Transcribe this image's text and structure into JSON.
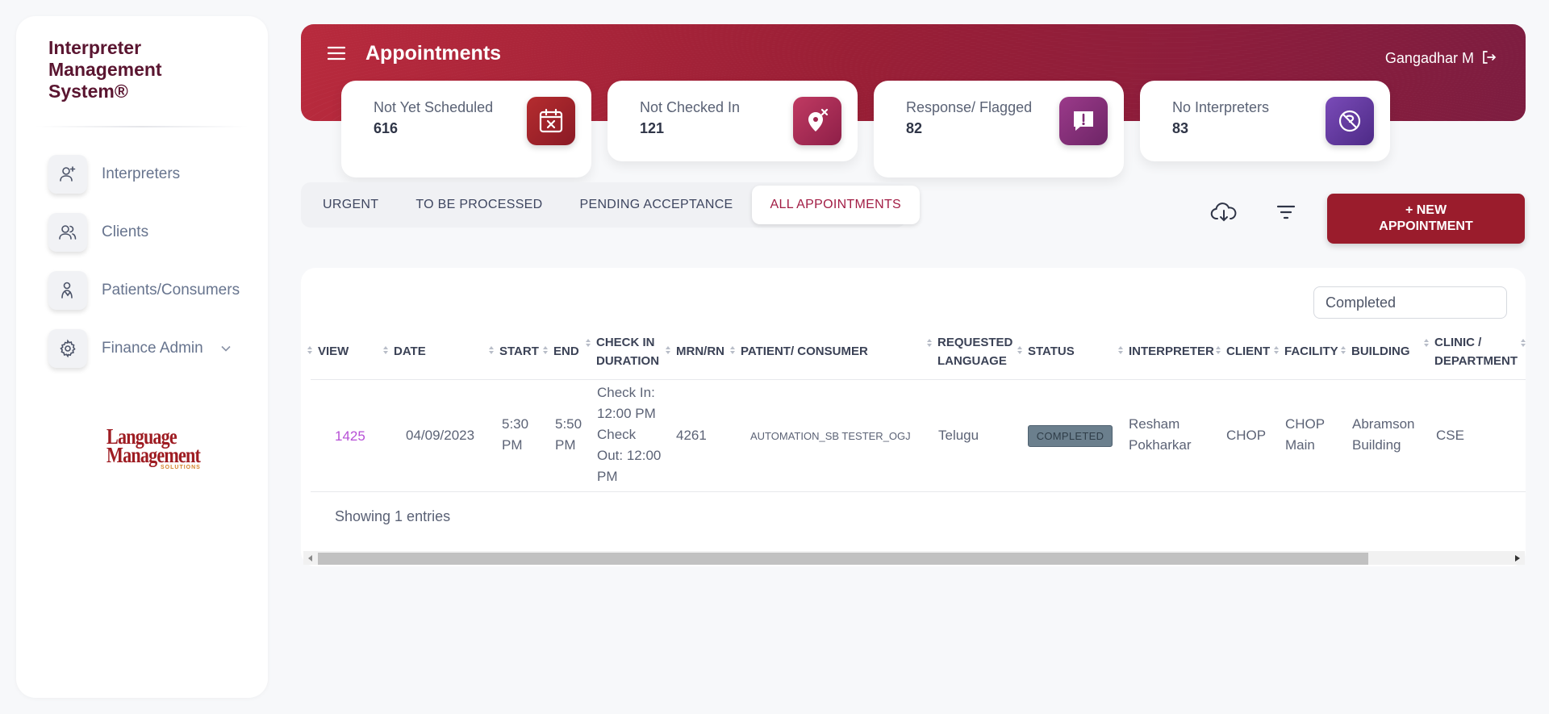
{
  "app": {
    "title": "Interpreter Management System®"
  },
  "sidebar": {
    "items": [
      {
        "label": "Interpreters",
        "icon": "user-plus-icon"
      },
      {
        "label": "Clients",
        "icon": "users-icon"
      },
      {
        "label": "Patients/Consumers",
        "icon": "patient-icon"
      },
      {
        "label": "Finance Admin",
        "icon": "gear-icon",
        "expandable": true
      }
    ],
    "logo": {
      "line1": "Language",
      "line2": "Management",
      "line3": "SOLUTIONS"
    }
  },
  "header": {
    "title": "Appointments",
    "user_name": "Gangadhar M",
    "colors": {
      "primary": "#9a1f36",
      "accent": "#a21d45"
    }
  },
  "stats": [
    {
      "label": "Not Yet Scheduled",
      "value": "616",
      "icon": "calendar-x-icon",
      "color": "#9a1f2a"
    },
    {
      "label": "Not Checked In",
      "value": "121",
      "icon": "location-x-icon",
      "color": "#a0254e"
    },
    {
      "label": "Response/ Flagged",
      "value": "82",
      "icon": "flag-message-icon",
      "color": "#7e2a73"
    },
    {
      "label": "No Interpreters",
      "value": "83",
      "icon": "no-interpreter-icon",
      "color": "#5a3592"
    }
  ],
  "tabs": [
    {
      "label": "URGENT",
      "active": false
    },
    {
      "label": "TO BE PROCESSED",
      "active": false
    },
    {
      "label": "PENDING ACCEPTANCE",
      "active": false
    },
    {
      "label": "ALL APPOINTMENTS",
      "active": true
    }
  ],
  "toolbar": {
    "download_icon": "cloud-download-icon",
    "filter_icon": "filter-icon",
    "new_button_label_1": "+ NEW",
    "new_button_label_2": "APPOINTMENT"
  },
  "table": {
    "filter_value": "Completed",
    "headers": {
      "view": "VIEW",
      "date": "DATE",
      "start": "START",
      "end": "END",
      "checkin_1": "CHECK IN",
      "checkin_2": "DURATION",
      "mrn": "MRN/RN",
      "patient": "PATIENT/ CONSUMER",
      "language_1": "REQUESTED",
      "language_2": "LANGUAGE",
      "status": "STATUS",
      "interpreter": "INTERPRETER",
      "client": "CLIENT",
      "facility": "FACILITY",
      "building": "BUILDING",
      "clinic_1": "CLINIC /",
      "clinic_2": "DEPARTMENT"
    },
    "rows": [
      {
        "view": "1425",
        "date": "04/09/2023",
        "start_1": "5:30",
        "start_2": "PM",
        "end_1": "5:50",
        "end_2": "PM",
        "checkin_1": "Check In:",
        "checkin_2": "12:00 PM",
        "checkin_3": "Check",
        "checkin_4": "Out: 12:00",
        "checkin_5": "PM",
        "mrn": "4261",
        "patient": "AUTOMATION_SB TESTER_OGJ",
        "language": "Telugu",
        "status": "COMPLETED",
        "interpreter_1": "Resham",
        "interpreter_2": "Pokharkar",
        "client": "CHOP",
        "facility_1": "CHOP",
        "facility_2": "Main",
        "building_1": "Abramson",
        "building_2": "Building",
        "clinic": "CSE"
      }
    ],
    "footer": "Showing 1 entries"
  }
}
